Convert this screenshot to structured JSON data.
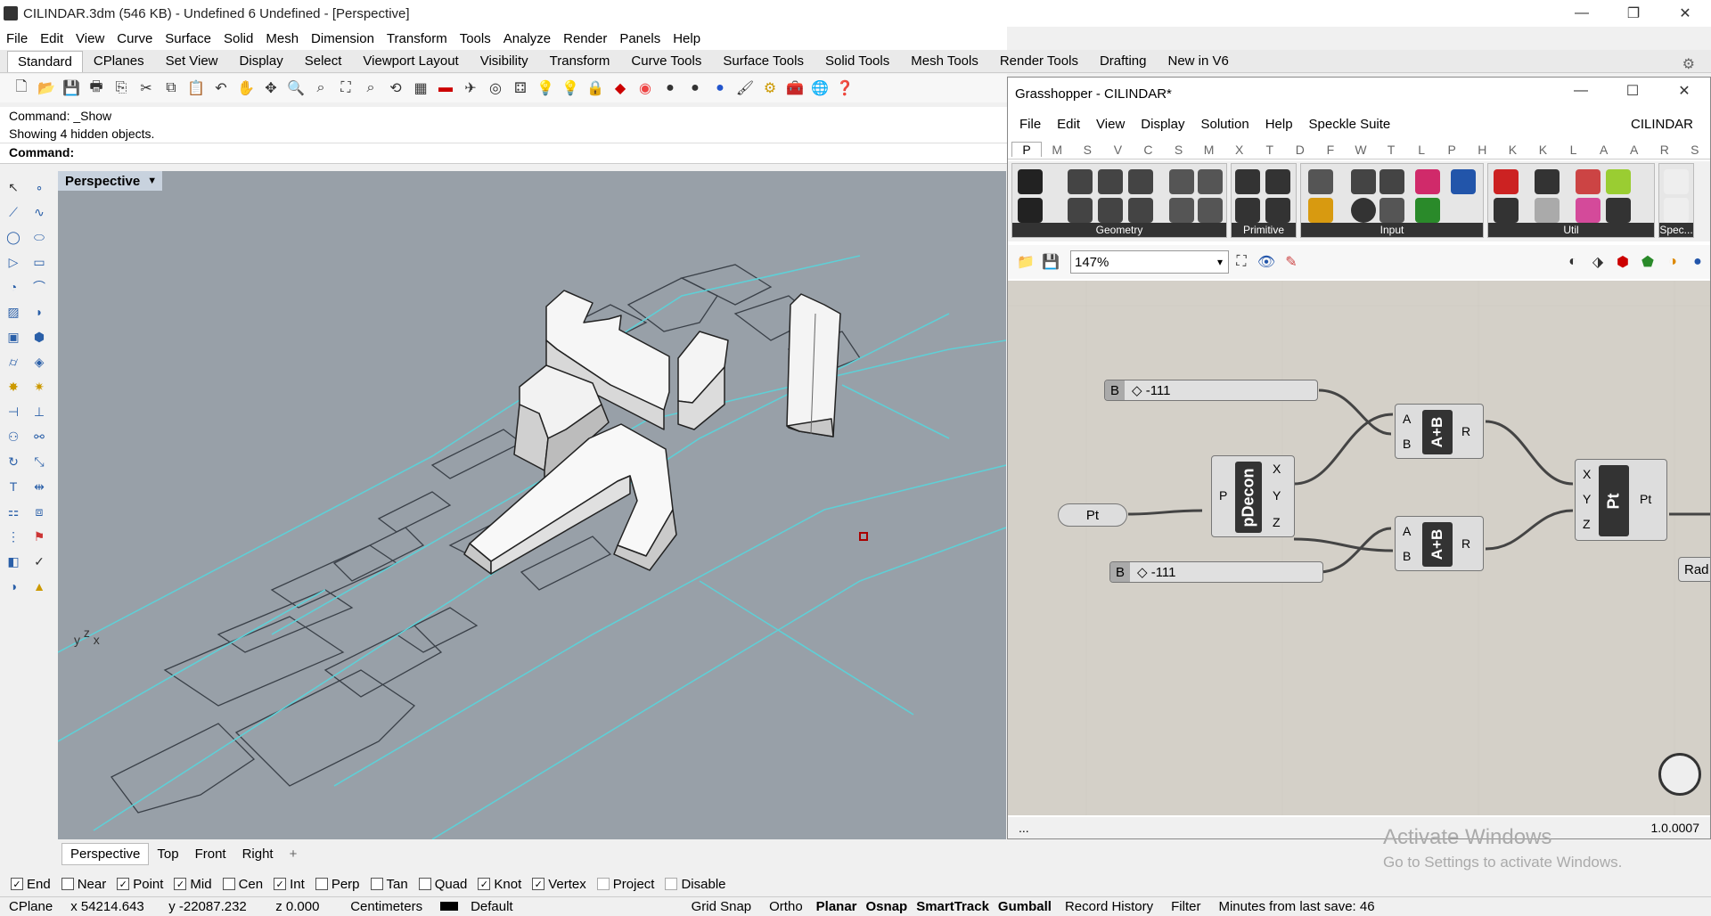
{
  "window": {
    "title": "CILINDAR.3dm (546 KB) - Undefined 6 Undefined - [Perspective]"
  },
  "menu": [
    "File",
    "Edit",
    "View",
    "Curve",
    "Surface",
    "Solid",
    "Mesh",
    "Dimension",
    "Transform",
    "Tools",
    "Analyze",
    "Render",
    "Panels",
    "Help"
  ],
  "tabs": [
    "Standard",
    "CPlanes",
    "Set View",
    "Display",
    "Select",
    "Viewport Layout",
    "Visibility",
    "Transform",
    "Curve Tools",
    "Surface Tools",
    "Solid Tools",
    "Mesh Tools",
    "Render Tools",
    "Drafting",
    "New in V6"
  ],
  "command": {
    "line1": "Command: _Show",
    "line2": "Showing 4 hidden objects.",
    "prompt": "Command:"
  },
  "viewport": {
    "label": "Perspective",
    "axes": [
      "y",
      "z",
      "x"
    ]
  },
  "viewtabs": [
    "Perspective",
    "Top",
    "Front",
    "Right"
  ],
  "osnap": [
    {
      "label": "End",
      "checked": true
    },
    {
      "label": "Near",
      "checked": false
    },
    {
      "label": "Point",
      "checked": true
    },
    {
      "label": "Mid",
      "checked": true
    },
    {
      "label": "Cen",
      "checked": false
    },
    {
      "label": "Int",
      "checked": true
    },
    {
      "label": "Perp",
      "checked": false
    },
    {
      "label": "Tan",
      "checked": false
    },
    {
      "label": "Quad",
      "checked": false
    },
    {
      "label": "Knot",
      "checked": true
    },
    {
      "label": "Vertex",
      "checked": true
    },
    {
      "label": "Project",
      "checked": false
    },
    {
      "label": "Disable",
      "checked": false
    }
  ],
  "status": {
    "cplane": "CPlane",
    "x": "x 54214.643",
    "y": "y -22087.232",
    "z": "z 0.000",
    "units": "Centimeters",
    "layer": "Default",
    "toggles": [
      "Grid Snap",
      "Ortho",
      "Planar",
      "Osnap",
      "SmartTrack",
      "Gumball",
      "Record History",
      "Filter"
    ],
    "bold": [
      "Planar",
      "Osnap",
      "SmartTrack",
      "Gumball"
    ],
    "saved": "Minutes from last save: 46"
  },
  "gh": {
    "title": "Grasshopper - CILINDAR*",
    "menu": [
      "File",
      "Edit",
      "View",
      "Display",
      "Solution",
      "Help",
      "Speckle Suite"
    ],
    "docname": "CILINDAR",
    "tabs": [
      "P",
      "M",
      "S",
      "V",
      "C",
      "S",
      "M",
      "X",
      "T",
      "D",
      "F",
      "W",
      "T",
      "L",
      "P",
      "H",
      "K",
      "K",
      "L",
      "A",
      "A",
      "R",
      "S"
    ],
    "groups": [
      "Geometry",
      "Primitive",
      "Input",
      "Util",
      "Spec..."
    ],
    "zoom": "147%",
    "footer_left": "...",
    "version": "1.0.0007",
    "slider1": {
      "label": "B",
      "value": "◇ -111"
    },
    "slider2": {
      "label": "B",
      "value": "◇ -111"
    },
    "pt_param": "Pt",
    "decon": {
      "name": "pDecon",
      "input": "P",
      "outputs": [
        "X",
        "Y",
        "Z"
      ]
    },
    "add1": {
      "name": "A+B",
      "inputs": [
        "A",
        "B"
      ],
      "output": "R"
    },
    "add2": {
      "name": "A+B",
      "inputs": [
        "A",
        "B"
      ],
      "output": "R"
    },
    "ptcomp": {
      "name": "Pt",
      "inputs": [
        "X",
        "Y",
        "Z"
      ],
      "output": "Pt"
    },
    "rad": "Rad"
  },
  "watermark": {
    "line1": "Activate Windows",
    "line2": "Go to Settings to activate Windows."
  }
}
